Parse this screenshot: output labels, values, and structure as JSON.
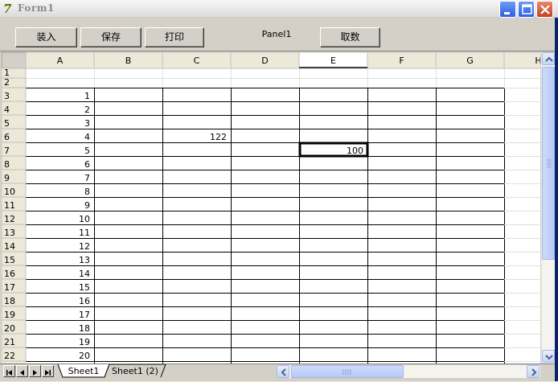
{
  "window": {
    "title": "Form1"
  },
  "toolbar": {
    "load_label": "装入",
    "save_label": "保存",
    "print_label": "打印",
    "panel_label": "Panel1",
    "fetch_label": "取数"
  },
  "sheet": {
    "columns": [
      "A",
      "B",
      "C",
      "D",
      "E",
      "F",
      "G",
      "H"
    ],
    "rows": [
      "1",
      "2",
      "3",
      "4",
      "5",
      "6",
      "7",
      "8",
      "9",
      "10",
      "11",
      "12",
      "13",
      "14",
      "15",
      "16",
      "17",
      "18",
      "19",
      "20",
      "21",
      "22"
    ],
    "cells": [
      {
        "col": "A",
        "row": 3,
        "value": "1"
      },
      {
        "col": "A",
        "row": 4,
        "value": "2"
      },
      {
        "col": "A",
        "row": 5,
        "value": "3"
      },
      {
        "col": "A",
        "row": 6,
        "value": "4"
      },
      {
        "col": "A",
        "row": 7,
        "value": "5"
      },
      {
        "col": "A",
        "row": 8,
        "value": "6"
      },
      {
        "col": "A",
        "row": 9,
        "value": "7"
      },
      {
        "col": "A",
        "row": 10,
        "value": "8"
      },
      {
        "col": "A",
        "row": 11,
        "value": "9"
      },
      {
        "col": "A",
        "row": 12,
        "value": "10"
      },
      {
        "col": "A",
        "row": 13,
        "value": "11"
      },
      {
        "col": "A",
        "row": 14,
        "value": "12"
      },
      {
        "col": "A",
        "row": 15,
        "value": "13"
      },
      {
        "col": "A",
        "row": 16,
        "value": "14"
      },
      {
        "col": "A",
        "row": 17,
        "value": "15"
      },
      {
        "col": "A",
        "row": 18,
        "value": "16"
      },
      {
        "col": "A",
        "row": 19,
        "value": "17"
      },
      {
        "col": "A",
        "row": 20,
        "value": "18"
      },
      {
        "col": "A",
        "row": 21,
        "value": "19"
      },
      {
        "col": "A",
        "row": 22,
        "value": "20"
      },
      {
        "col": "C",
        "row": 6,
        "value": "122"
      },
      {
        "col": "E",
        "row": 7,
        "value": "100"
      }
    ],
    "active_cell": {
      "col": "E",
      "row": 7
    },
    "tabs": [
      {
        "label": "Sheet1",
        "active": true
      },
      {
        "label": "Sheet1 (2)",
        "active": false
      }
    ]
  }
}
